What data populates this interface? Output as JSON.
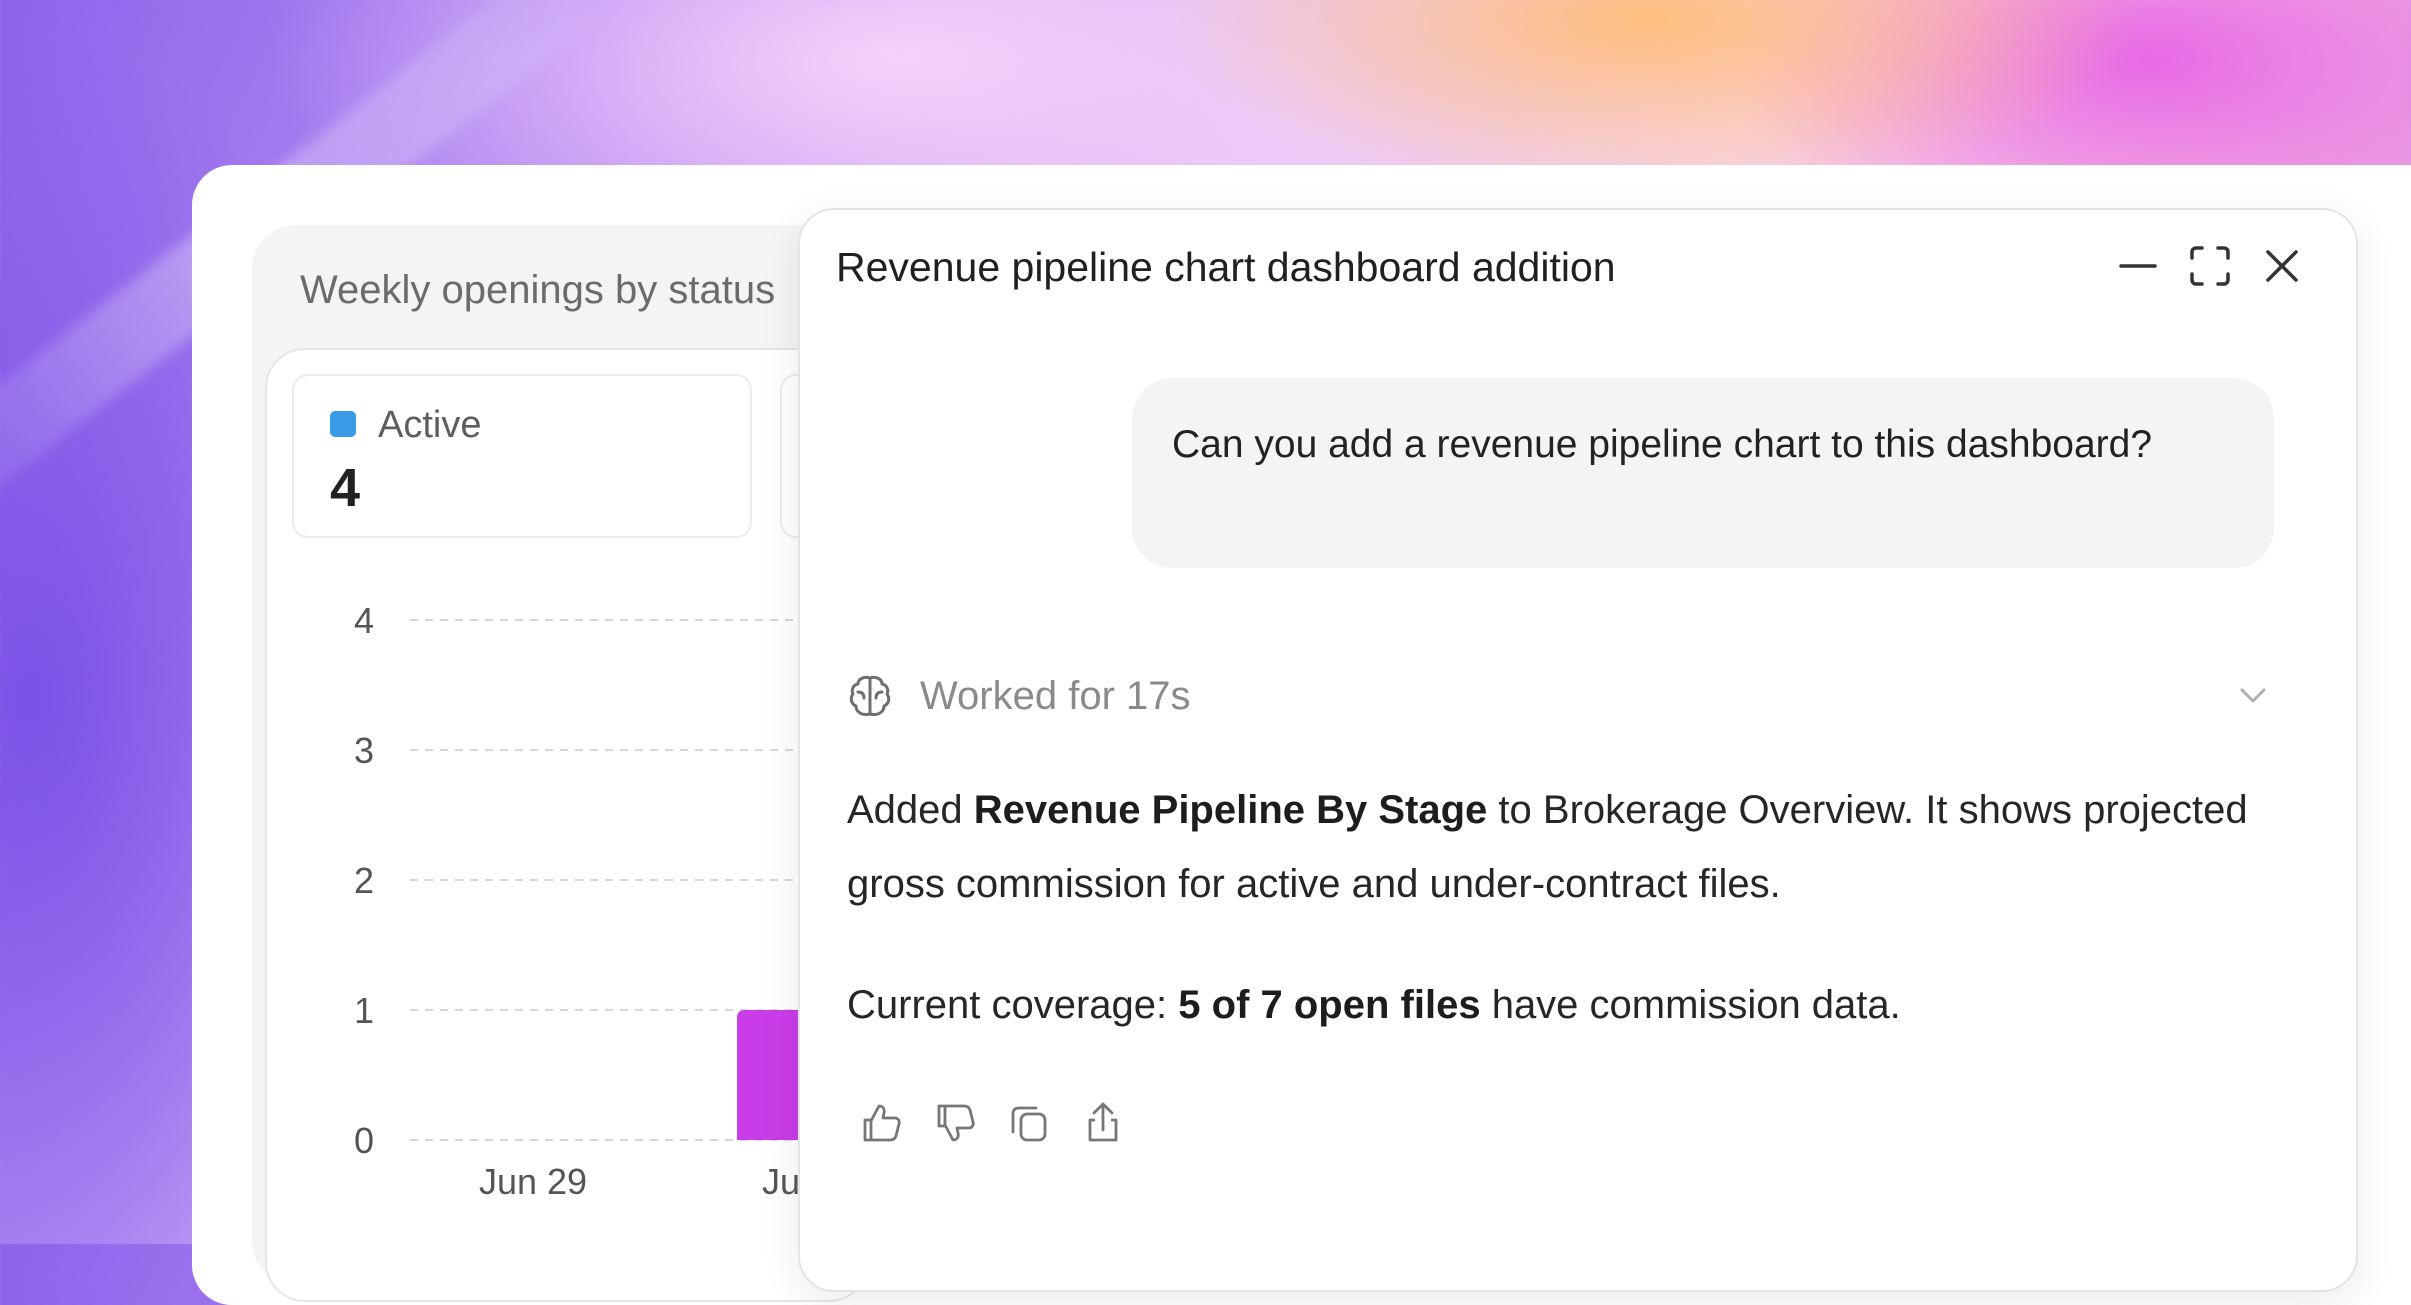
{
  "widget": {
    "title": "Weekly openings by status",
    "legend": {
      "label": "Active",
      "color": "#3a9be6"
    },
    "stat_value": "4"
  },
  "chart_data": {
    "type": "bar",
    "categories": [
      "Jun 29",
      "Jul"
    ],
    "values": [
      0,
      1
    ],
    "yticks": [
      "0",
      "1",
      "2",
      "3",
      "4"
    ],
    "ylim": [
      0,
      4
    ],
    "bar_color": "#c93de8",
    "grid": "dashed"
  },
  "panel": {
    "title": "Revenue pipeline chart dashboard addition",
    "user_message": "Can you add a revenue pipeline chart to this dashboard?",
    "worked_label": "Worked for 17s",
    "msg1": {
      "prefix": "Added ",
      "bold": "Revenue Pipeline By Stage",
      "suffix": " to Brokerage Overview. It shows projected gross commission for active and under-contract files."
    },
    "msg2": {
      "prefix": "Current coverage: ",
      "bold": "5 of 7 open files",
      "suffix": " have commission data."
    }
  },
  "icons": {
    "minimize": "minimize-icon",
    "expand": "expand-icon",
    "close": "close-icon",
    "brain": "brain-icon",
    "chevron": "chevron-down-icon",
    "like": "thumbs-up-icon",
    "dislike": "thumbs-down-icon",
    "copy": "copy-icon",
    "share": "share-icon"
  }
}
